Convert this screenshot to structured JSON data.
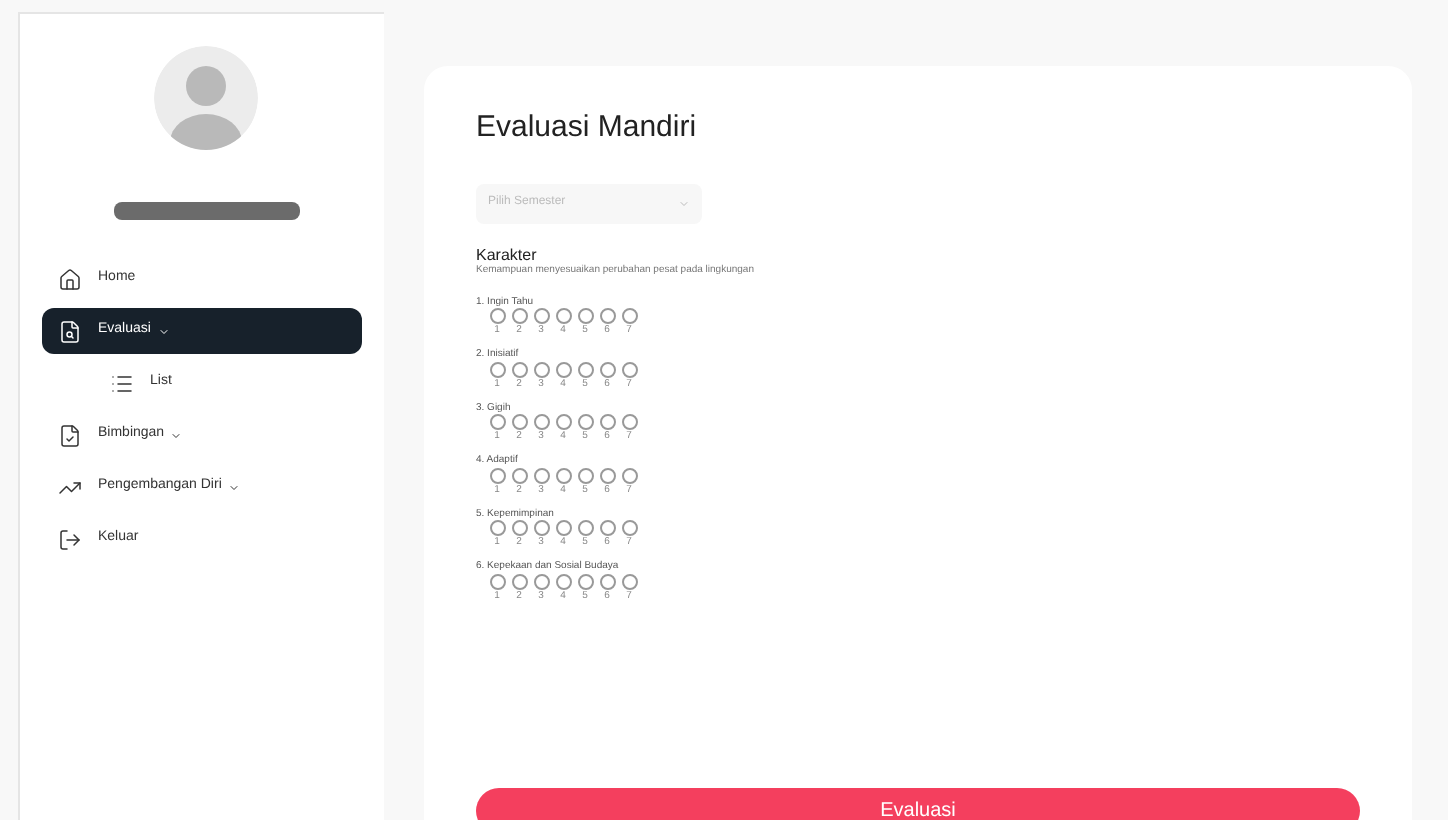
{
  "sidebar": {
    "items": [
      {
        "label": "Home",
        "kind": "link",
        "selected": false
      },
      {
        "label": "Evaluasi",
        "kind": "dropdown",
        "selected": true,
        "children": [
          {
            "label": "List",
            "selected": false
          }
        ]
      },
      {
        "label": "Bimbingan",
        "kind": "dropdown",
        "selected": false
      },
      {
        "label": "Pengembangan Diri",
        "kind": "dropdown",
        "selected": false
      },
      {
        "label": "Keluar",
        "kind": "link",
        "selected": false
      }
    ]
  },
  "page": {
    "title": "Evaluasi Mandiri",
    "semester_select": {
      "placeholder": "Pilih Semester"
    },
    "section": {
      "title": "Karakter",
      "description": "Kemampuan menyesuaikan perubahan pesat pada lingkungan"
    },
    "questions": [
      {
        "label": "1. Ingin Tahu",
        "options": [
          {
            "label": "1",
            "selected": false
          },
          {
            "label": "2",
            "selected": false
          },
          {
            "label": "3",
            "selected": false
          },
          {
            "label": "4",
            "selected": false
          },
          {
            "label": "5",
            "selected": false
          },
          {
            "label": "6",
            "selected": false
          },
          {
            "label": "7",
            "selected": false
          }
        ]
      },
      {
        "label": "2. Inisiatif",
        "options": [
          {
            "label": "1",
            "selected": false
          },
          {
            "label": "2",
            "selected": false
          },
          {
            "label": "3",
            "selected": false
          },
          {
            "label": "4",
            "selected": false
          },
          {
            "label": "5",
            "selected": false
          },
          {
            "label": "6",
            "selected": false
          },
          {
            "label": "7",
            "selected": false
          }
        ]
      },
      {
        "label": "3. Gigih",
        "options": [
          {
            "label": "1",
            "selected": false
          },
          {
            "label": "2",
            "selected": false
          },
          {
            "label": "3",
            "selected": false
          },
          {
            "label": "4",
            "selected": false
          },
          {
            "label": "5",
            "selected": false
          },
          {
            "label": "6",
            "selected": false
          },
          {
            "label": "7",
            "selected": false
          }
        ]
      },
      {
        "label": "4. Adaptif",
        "options": [
          {
            "label": "1",
            "selected": false
          },
          {
            "label": "2",
            "selected": false
          },
          {
            "label": "3",
            "selected": false
          },
          {
            "label": "4",
            "selected": false
          },
          {
            "label": "5",
            "selected": false
          },
          {
            "label": "6",
            "selected": false
          },
          {
            "label": "7",
            "selected": false
          }
        ]
      },
      {
        "label": "5. Kepemimpinan",
        "options": [
          {
            "label": "1",
            "selected": false
          },
          {
            "label": "2",
            "selected": false
          },
          {
            "label": "3",
            "selected": false
          },
          {
            "label": "4",
            "selected": false
          },
          {
            "label": "5",
            "selected": false
          },
          {
            "label": "6",
            "selected": false
          },
          {
            "label": "7",
            "selected": false
          }
        ]
      },
      {
        "label": "6. Kepekaan dan Sosial Budaya",
        "options": [
          {
            "label": "1",
            "selected": false
          },
          {
            "label": "2",
            "selected": false
          },
          {
            "label": "3",
            "selected": false
          },
          {
            "label": "4",
            "selected": false
          },
          {
            "label": "5",
            "selected": false
          },
          {
            "label": "6",
            "selected": false
          },
          {
            "label": "7",
            "selected": false
          }
        ]
      }
    ],
    "submit": "Evaluasi"
  }
}
